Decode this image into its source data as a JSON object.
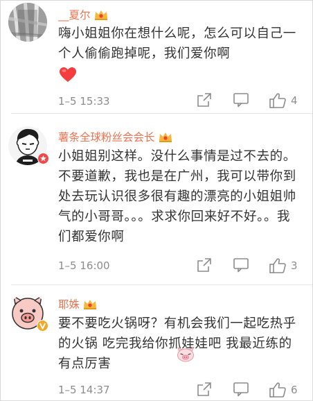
{
  "comments": [
    {
      "username": "__夏尔",
      "text": "嗨小姐姐你在想什么呢，怎么可以自己一个人偷偷跑掉呢，我们爱你啊",
      "emoji": "red-heart",
      "time": "1–5 15:33",
      "likes": "4"
    },
    {
      "username": "薯条全球粉丝会会长",
      "text": "小姐姐别这样。没什么事情是过不去的。不要道歉，我也是在广州，我可以带你到处去玩认识很多很有趣的漂亮的小姐姐帅气的小哥哥。。。求求你回来好不好。。我们都爱你啊",
      "time": "1–5 16:00",
      "likes": "3"
    },
    {
      "username": "耶姝",
      "text": "要不要吃火锅呀？有机会我们一起吃热乎的火锅 吃完我给你抓娃娃吧 我最近练的有点厉害",
      "emoji": "pig-face",
      "time": "1–5 14:37",
      "likes": "6"
    }
  ],
  "colors": {
    "username": "#eb7350",
    "text": "#333333",
    "meta": "#8c8c8c",
    "separator": "#e6e6e6"
  },
  "icons": [
    "vip-crown-icon",
    "share-icon",
    "comment-icon",
    "like-icon",
    "verified-badge-icon"
  ]
}
